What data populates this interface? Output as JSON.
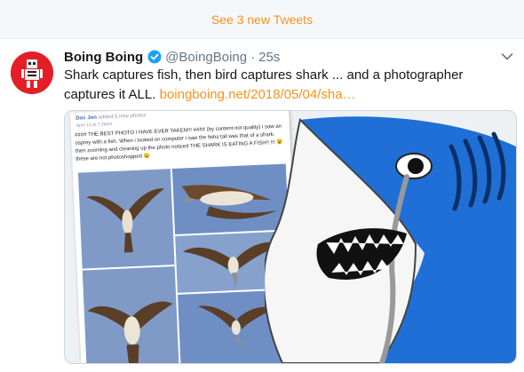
{
  "banner": {
    "label": "See 3 new Tweets"
  },
  "tweet": {
    "display_name": "Boing Boing",
    "handle": "@BoingBoing",
    "separator": "·",
    "time": "25s",
    "text": "Shark captures fish, then bird captures shark ... and a photographer captures it ALL.",
    "link": "boingboing.net/2018/05/04/sha…",
    "verified_icon": "verified-badge-icon",
    "menu_icon": "chevron-down-icon"
  },
  "media": {
    "poster": "Doc Jon",
    "poster_action": "added 5 new photos",
    "post_meta": "April 13 at 7:19am ·",
    "post_text": "#### THE BEST PHOTO I HAVE EVER TAKEN!!! ####  (by content not quality) i saw an osprey with a fish. When i looked on computer i saw the fishs tail was that of a shark. then zooming and cleaning up the photo noticed THE SHARK IS EATING A FISH!! !!! 😮 these are not photoshopped 😉"
  },
  "colors": {
    "accent": "#f7921e",
    "avatar_red": "#e41e26",
    "verified_blue": "#1da1f2",
    "shark_blue": "#1f6fd6",
    "sky_blue": "#7f9ac7"
  }
}
